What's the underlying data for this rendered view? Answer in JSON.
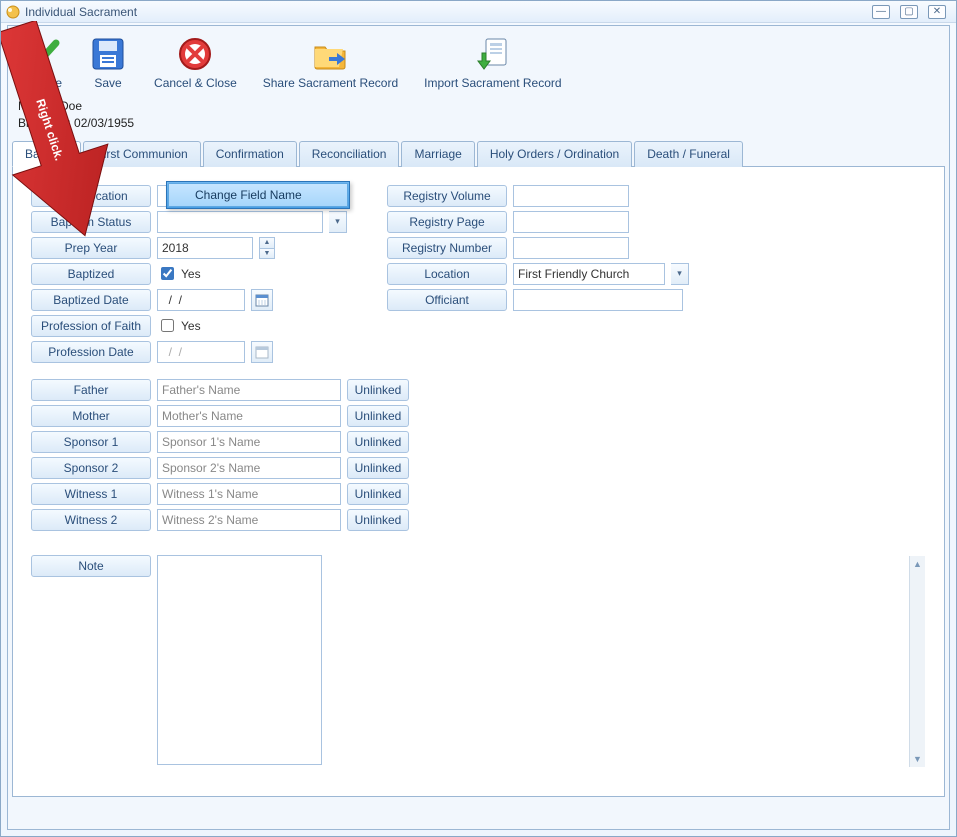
{
  "window": {
    "title": "Individual Sacrament"
  },
  "toolbar": {
    "save_close": "& Close",
    "save_close_full": "Save & Close",
    "save": "Save",
    "cancel_close": "Cancel & Close",
    "share": "Share Sacrament Record",
    "import": "Import Sacrament Record"
  },
  "person": {
    "name_prefix_line": "Mr",
    "name_suffix_line": "n Doe",
    "birth_line_prefix": "Birth",
    "birth_line_suffix": "e: 02/03/1955"
  },
  "tabs": [
    "Baptism",
    "First Communion",
    "Confirmation",
    "Reconciliation",
    "Marriage",
    "Holy Orders / Ordination",
    "Death / Funeral"
  ],
  "fields_left": {
    "birth_location": "Birth Location",
    "baptism_status": "Baptism Status",
    "prep_year": "Prep Year",
    "prep_year_value": "2018",
    "baptized": "Baptized",
    "baptized_yes": "Yes",
    "baptized_date": "Baptized Date",
    "baptized_date_value": "  /  /",
    "prof_faith": "Profession of Faith",
    "prof_faith_yes": "Yes",
    "prof_date": "Profession Date",
    "prof_date_value": "  /  /"
  },
  "fields_right": {
    "reg_volume": "Registry Volume",
    "reg_page": "Registry Page",
    "reg_number": "Registry Number",
    "location": "Location",
    "location_value": "First Friendly Church",
    "officiant": "Officiant"
  },
  "people": [
    {
      "label": "Father",
      "placeholder": "Father's Name",
      "link": "Unlinked"
    },
    {
      "label": "Mother",
      "placeholder": "Mother's Name",
      "link": "Unlinked"
    },
    {
      "label": "Sponsor 1",
      "placeholder": "Sponsor 1's Name",
      "link": "Unlinked"
    },
    {
      "label": "Sponsor 2",
      "placeholder": "Sponsor 2's Name",
      "link": "Unlinked"
    },
    {
      "label": "Witness 1",
      "placeholder": "Witness 1's Name",
      "link": "Unlinked"
    },
    {
      "label": "Witness 2",
      "placeholder": "Witness 2's Name",
      "link": "Unlinked"
    }
  ],
  "note_label": "Note",
  "context_menu": {
    "change_field_name": "Change Field Name"
  },
  "arrow_text": "Right click."
}
